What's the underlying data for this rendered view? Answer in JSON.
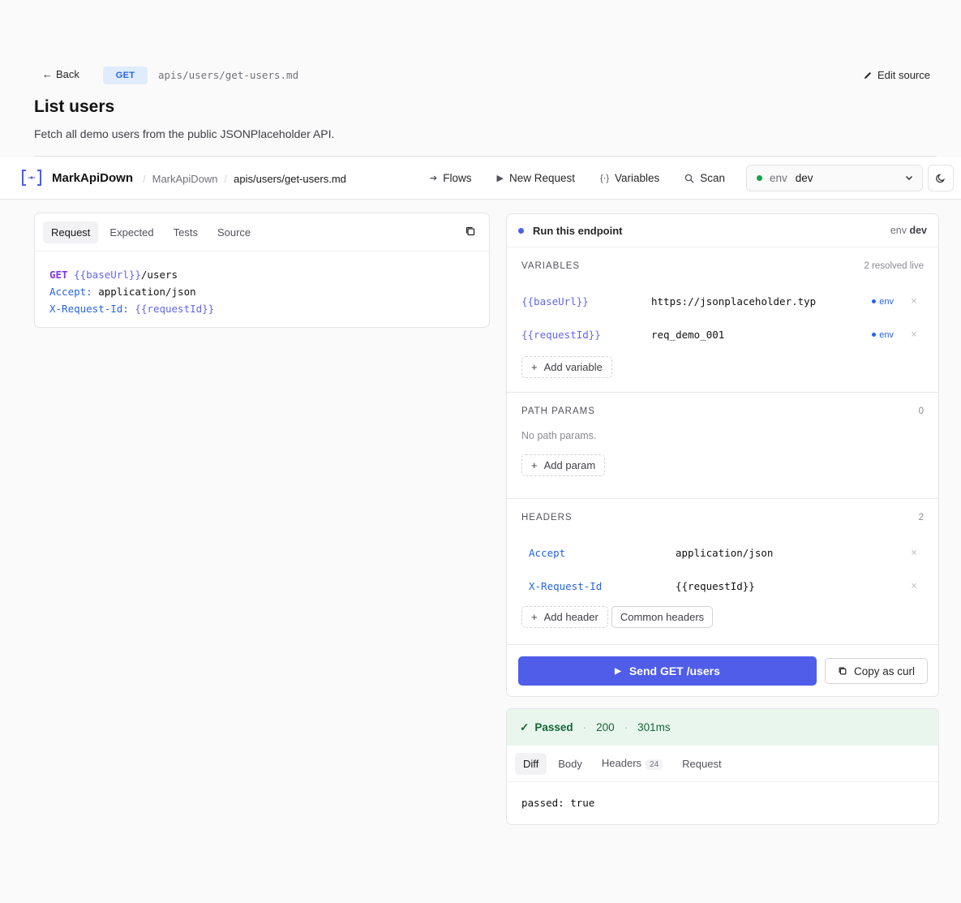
{
  "page": {
    "back_label": "Back",
    "method": "GET",
    "file_path": "apis/users/get-users.md",
    "edit_source_label": "Edit source",
    "title": "List users",
    "description": "Fetch all demo users from the public JSONPlaceholder API."
  },
  "nav": {
    "brand": "MarkApiDown",
    "breadcrumb_root": "MarkApiDown",
    "breadcrumb_current": "apis/users/get-users.md",
    "links": [
      {
        "label": "Flows",
        "icon": "arrow-right-icon"
      },
      {
        "label": "New Request",
        "icon": "play-icon"
      },
      {
        "label": "Variables",
        "icon": "braces-icon"
      },
      {
        "label": "Scan",
        "icon": "search-icon"
      }
    ],
    "env_label": "env",
    "env_value": "dev"
  },
  "editor": {
    "tabs": [
      "Request",
      "Expected",
      "Tests",
      "Source"
    ],
    "active_tab": "Request",
    "code": {
      "method": "GET",
      "url_var": "{{baseUrl}}",
      "url_path": "/users",
      "h1_key": "Accept:",
      "h1_val": "application/json",
      "h2_key": "X-Request-Id:",
      "h2_val": "{{requestId}}"
    }
  },
  "runner": {
    "title": "Run this endpoint",
    "env_label": "env",
    "env_value": "dev",
    "variables": {
      "title": "VARIABLES",
      "meta": "2 resolved live",
      "items": [
        {
          "key": "{{baseUrl}}",
          "value": "https://jsonplaceholder.typ",
          "source": "env"
        },
        {
          "key": "{{requestId}}",
          "value": "req_demo_001",
          "source": "env"
        }
      ],
      "add_label": "Add variable"
    },
    "path_params": {
      "title": "PATH PARAMS",
      "meta": "0",
      "empty": "No path params.",
      "add_label": "Add param"
    },
    "headers": {
      "title": "HEADERS",
      "meta": "2",
      "items": [
        {
          "key": "Accept",
          "value": "application/json"
        },
        {
          "key": "X-Request-Id",
          "value": "{{requestId}}"
        }
      ],
      "add_label": "Add header",
      "common_label": "Common headers"
    },
    "send_label": "Send GET /users",
    "curl_label": "Copy as curl"
  },
  "result": {
    "status_label": "Passed",
    "status_code": "200",
    "duration": "301ms",
    "tabs": [
      "Diff",
      "Body",
      "Headers",
      "Request"
    ],
    "headers_count": "24",
    "active_tab": "Diff",
    "body": "passed: true"
  },
  "colors": {
    "accent": "#4f5de8",
    "method_badge_bg": "#e0ecfb",
    "success_bg": "#e9f6ee",
    "success_text": "#166534"
  }
}
